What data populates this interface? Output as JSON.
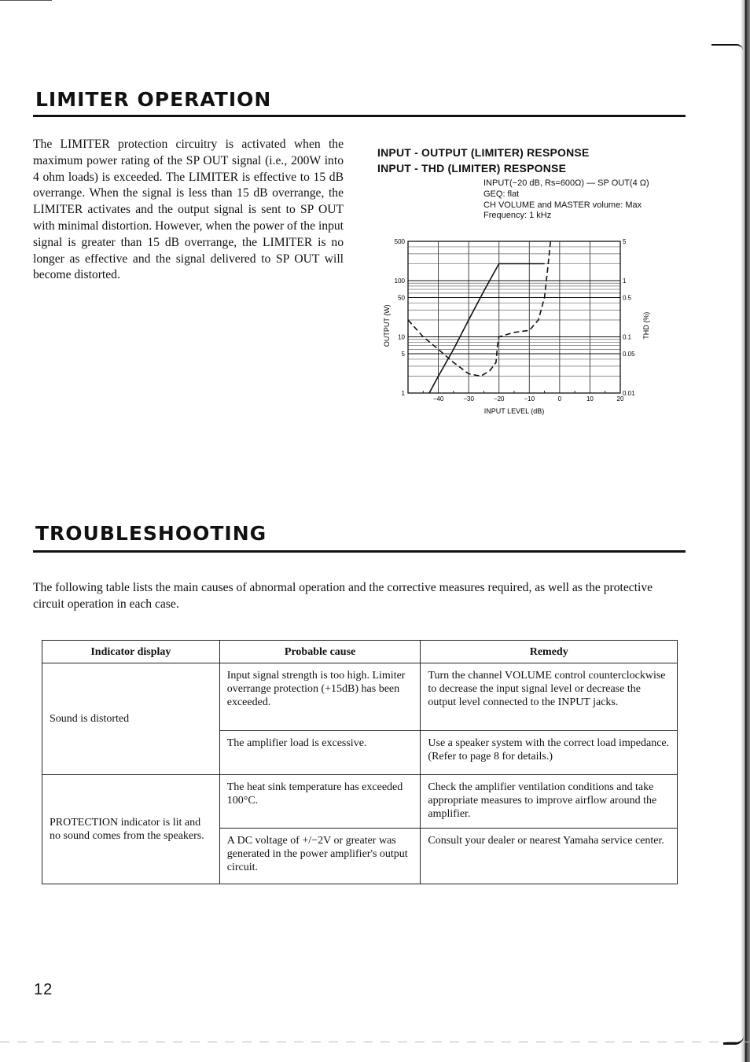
{
  "limiter_section": {
    "title": "LIMITER OPERATION",
    "body": "The LIMITER protection circuitry is activated when the maximum power rating of the SP OUT signal (i.e., 200W into 4 ohm loads) is exceeded. The LIMITER is effective to 15 dB overrange. When the signal is less than 15 dB overrange, the LIMITER activates and the output signal is sent to SP OUT with minimal distortion. However, when the power of the input signal is greater than 15 dB overrange, the LIMITER is no longer as effective and the signal delivered to SP OUT will become distorted."
  },
  "chart_headings": {
    "line1": "INPUT - OUTPUT (LIMITER) RESPONSE",
    "line2": "INPUT - THD (LIMITER) RESPONSE",
    "notes": [
      "INPUT(−20 dB, Rs=600Ω) — SP OUT(4 Ω)",
      "GEQ: flat",
      "CH VOLUME and MASTER volume: Max",
      "Frequency: 1 kHz"
    ]
  },
  "chart_data": {
    "type": "line",
    "title": "INPUT - OUTPUT (LIMITER) RESPONSE / INPUT - THD (LIMITER) RESPONSE",
    "xlabel": "INPUT LEVEL (dB)",
    "ylabel": "OUTPUT (W)",
    "y2label": "THD (%)",
    "xlim": [
      -50,
      20
    ],
    "ylim": [
      1,
      500
    ],
    "y2lim": [
      0.01,
      5
    ],
    "yscale": "log",
    "y2scale": "log",
    "grid": true,
    "x_ticks": [
      -40,
      -30,
      -20,
      -10,
      0,
      10,
      20
    ],
    "x_tick_labels": [
      "−40",
      "−30",
      "−20",
      "−10",
      "0",
      "10",
      "20"
    ],
    "y_ticks": [
      1,
      5,
      10,
      50,
      100,
      500
    ],
    "y_tick_labels": [
      "1",
      "5",
      "10",
      "50",
      "100",
      "500"
    ],
    "y2_ticks": [
      0.01,
      0.05,
      0.1,
      0.5,
      1,
      5
    ],
    "y2_tick_labels": [
      "0.01",
      "0.05",
      "0.1",
      "0.5",
      "1",
      "5"
    ],
    "series": [
      {
        "name": "Output (W)",
        "axis": "left",
        "style": "solid",
        "x": [
          -43,
          -40,
          -35,
          -30,
          -25,
          -20,
          -15,
          -10,
          -5
        ],
        "values": [
          1,
          2,
          6,
          20,
          65,
          200,
          200,
          200,
          200
        ]
      },
      {
        "name": "THD (%)",
        "axis": "right",
        "style": "dashed",
        "x": [
          -50,
          -45,
          -40,
          -35,
          -30,
          -26,
          -23,
          -21,
          -20.5,
          -20,
          -15,
          -10,
          -7,
          -5,
          -4,
          -3
        ],
        "values": [
          0.2,
          0.1,
          0.06,
          0.035,
          0.022,
          0.02,
          0.025,
          0.035,
          0.07,
          0.1,
          0.12,
          0.13,
          0.2,
          0.5,
          1.5,
          5
        ]
      }
    ]
  },
  "troubleshooting_section": {
    "title": "TROUBLESHOOTING",
    "intro": "The following table lists the main causes of abnormal operation and the corrective measures required, as well as the protective circuit operation in each case."
  },
  "table": {
    "headers": [
      "Indicator display",
      "Probable cause",
      "Remedy"
    ],
    "groups": [
      {
        "indicator": "Sound is distorted",
        "rows": [
          {
            "cause": "Input signal strength is too high. Limiter overrange protection (+15dB) has been exceeded.",
            "remedy": "Turn the channel VOLUME control counterclockwise to decrease the input signal level or decrease the output level connected to the INPUT jacks."
          },
          {
            "cause": "The amplifier load is excessive.",
            "remedy": "Use a speaker system with the correct load impedance. (Refer to page 8 for details.)"
          }
        ]
      },
      {
        "indicator": "PROTECTION indicator is lit and no sound comes from the speakers.",
        "rows": [
          {
            "cause": "The heat sink temperature has exceeded 100°C.",
            "remedy": "Check the amplifier ventilation conditions and take appropriate measures to improve airflow around the amplifier."
          },
          {
            "cause": "A DC voltage of +/−2V or greater was generated in the power amplifier's output circuit.",
            "remedy": "Consult your dealer or nearest Yamaha service center."
          }
        ]
      }
    ]
  },
  "page": {
    "number": "12"
  }
}
